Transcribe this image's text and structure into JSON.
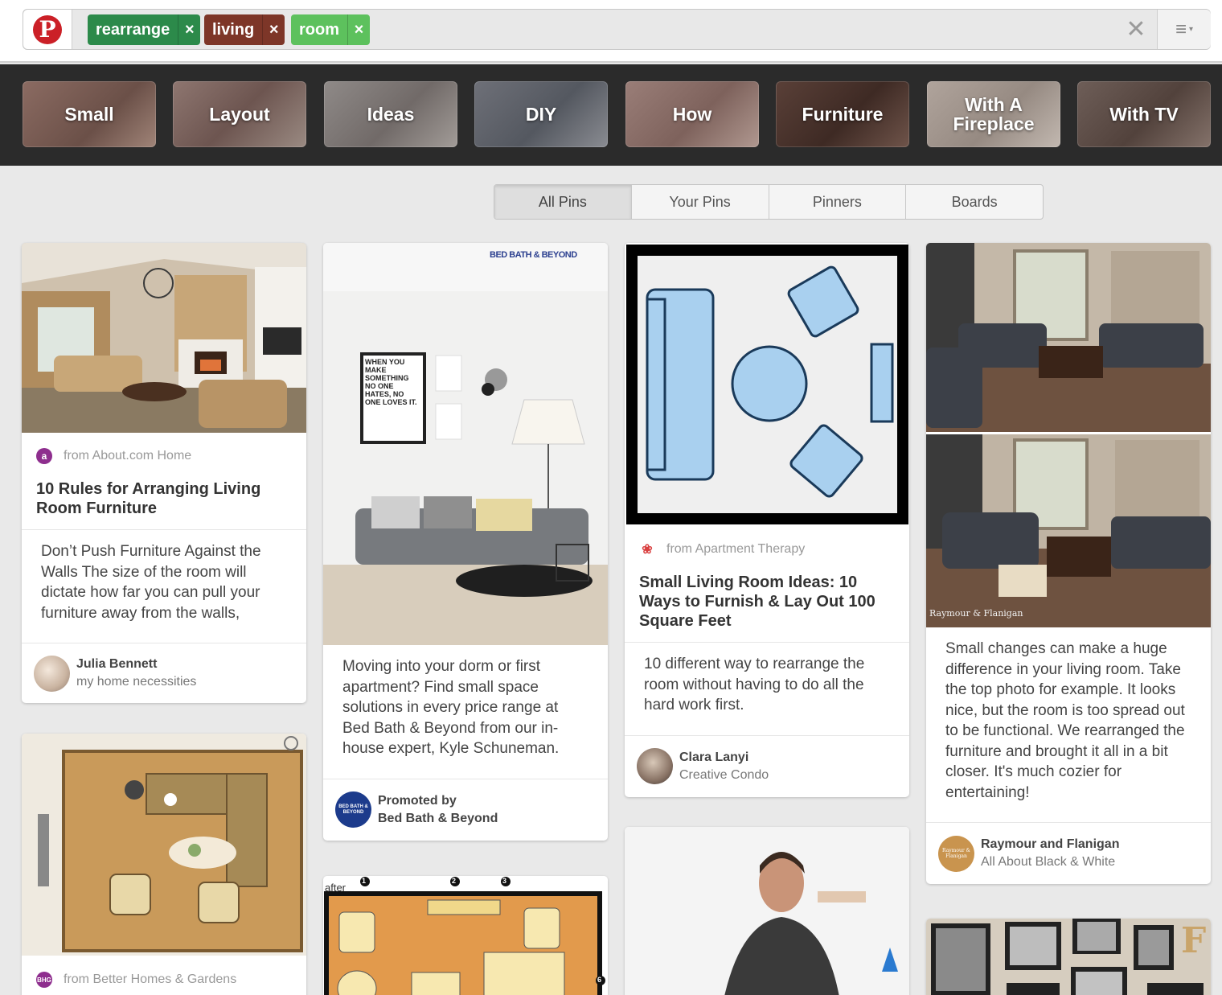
{
  "search": {
    "tokens": [
      {
        "label": "rearrange",
        "color": "#2c8a4a"
      },
      {
        "label": "living",
        "color": "#7d3628"
      },
      {
        "label": "room",
        "color": "#5dc15d"
      }
    ],
    "remove_glyph": "×",
    "clear_glyph": "✕",
    "menu_glyph": "≡",
    "menu_caret": "▾"
  },
  "brand": {
    "logo_letter": "P",
    "color": "#cb2027"
  },
  "guides": [
    "Small",
    "Layout",
    "Ideas",
    "DIY",
    "How",
    "Furniture",
    "With A Fireplace",
    "With TV"
  ],
  "tabs": [
    {
      "label": "All Pins",
      "active": true
    },
    {
      "label": "Your Pins",
      "active": false
    },
    {
      "label": "Pinners",
      "active": false
    },
    {
      "label": "Boards",
      "active": false
    }
  ],
  "pins": {
    "about": {
      "source": "from About.com Home",
      "source_icon": "a",
      "title": "10 Rules for Arranging Living Room Furniture",
      "description": "Don’t Push Furniture Against the Walls The size of the room will dictate how far you can pull your furniture away from the walls,",
      "pinner": "Julia Bennett",
      "board": "my home necessities"
    },
    "bhg": {
      "source": "from Better Homes & Gardens",
      "source_icon": "BHG"
    },
    "bbb": {
      "brand_mark": "BED BATH & BEYOND",
      "poster_text": "WHEN YOU MAKE SOMETHING NO ONE HATES, NO ONE LOVES IT.",
      "description": "Moving into your dorm or first apartment? Find small space solutions in every price range at Bed Bath & Beyond from our in-house expert, Kyle Schuneman.",
      "pinner": "Promoted by",
      "board": "Bed Bath & Beyond",
      "avatar_text": "BED BATH & BEYOND"
    },
    "floorplan2": {
      "label": "after",
      "markers": [
        "1",
        "2",
        "3",
        "6"
      ]
    },
    "apt": {
      "source": "from Apartment Therapy",
      "title": "Small Living Room Ideas: 10 Ways to Furnish & Lay Out 100 Square Feet",
      "description": "10 different way to rearrange the room without having to do all the hard work first.",
      "pinner": "Clara Lanyi",
      "board": "Creative Condo"
    },
    "raymour": {
      "watermark": "Raymour & Flanigan",
      "description": "Small changes can make a huge difference in your living room. Take the top photo for example. It looks nice, but the room is too spread out to be functional. We rearranged the furniture and brought it all in a bit closer. It's much cozier for entertaining!",
      "pinner": "Raymour and Flanigan",
      "board": "All About Black & White",
      "avatar_text": "Raymour & Flanigan"
    },
    "gallery": {
      "letter": "F"
    }
  }
}
